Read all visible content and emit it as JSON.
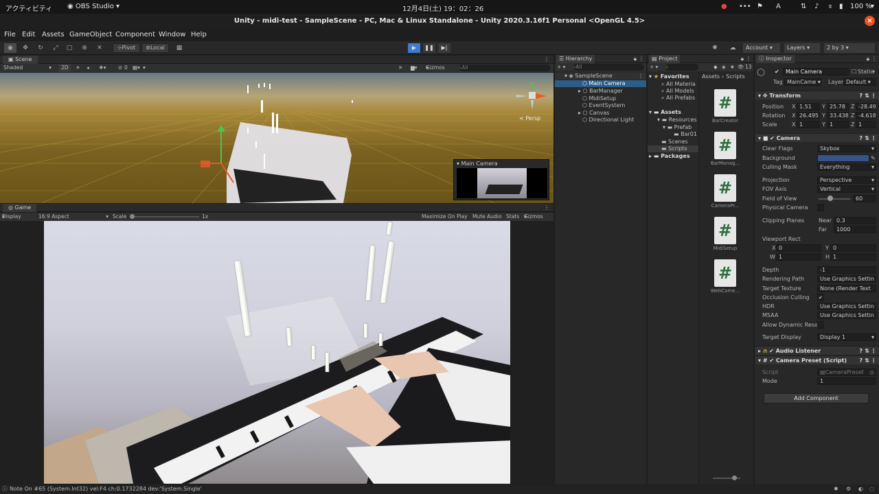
{
  "os_bar": {
    "activities": "アクティビティ",
    "app": "OBS Studio",
    "clock": "12月4日(土) 19：02：26",
    "input_method": "A",
    "battery": "100 %"
  },
  "window": {
    "title": "Unity - midi-test - SampleScene - PC, Mac & Linux Standalone - Unity 2020.3.16f1 Personal <OpenGL 4.5>",
    "close": "×"
  },
  "menu": [
    "File",
    "Edit",
    "Assets",
    "GameObject",
    "Component",
    "Window",
    "Help"
  ],
  "toolbar": {
    "pivot": "Pivot",
    "local": "Local",
    "account": "Account",
    "layers": "Layers",
    "layout": "2 by 3"
  },
  "scene": {
    "tab": "Scene",
    "shading": "Shaded",
    "mode_2d": "2D",
    "hidden_count": "0",
    "gizmos": "Gizmos",
    "search_placeholder": "All",
    "persp": "< Persp",
    "preview_title": "Main Camera"
  },
  "game": {
    "tab": "Game",
    "display": "Display 1",
    "aspect": "16:9 Aspect",
    "scale_label": "Scale",
    "scale_value": "1x",
    "maximize": "Maximize On Play",
    "mute": "Mute Audio",
    "stats": "Stats",
    "gizmos": "Gizmos"
  },
  "hierarchy": {
    "tab": "Hierarchy",
    "search_placeholder": "All",
    "scene": "SampleScene",
    "items": [
      "Main Camera",
      "BarManager",
      "MidiSetup",
      "EventSystem",
      "Canvas",
      "Directional Light"
    ]
  },
  "project": {
    "tab": "Project",
    "count": "13",
    "favorites": "Favorites",
    "fav_items": [
      "All Materia",
      "All Models",
      "All Prefabs"
    ],
    "assets": "Assets",
    "tree": [
      "Resources",
      "Prefab",
      "Bar01",
      "Scenes",
      "Scripts"
    ],
    "packages": "Packages",
    "breadcrumb_root": "Assets",
    "breadcrumb_sep": "›",
    "breadcrumb_leaf": "Scripts",
    "scripts": [
      "BarCreator",
      "BarManag...",
      "CameraPr...",
      "MidiSetup",
      "WebCame..."
    ]
  },
  "inspector": {
    "tab": "Inspector",
    "object_name": "Main Camera",
    "static": "Static",
    "tag_label": "Tag",
    "tag": "MainCame",
    "layer_label": "Layer",
    "layer": "Default",
    "transform": {
      "title": "Transform",
      "position_label": "Position",
      "rotation_label": "Rotation",
      "scale_label": "Scale",
      "position": [
        "1.51",
        "25.78",
        "-28.49"
      ],
      "rotation": [
        "26.495",
        "33.438",
        "-4.618"
      ],
      "scale": [
        "1",
        "1",
        "1"
      ]
    },
    "camera": {
      "title": "Camera",
      "clear_flags_label": "Clear Flags",
      "clear_flags": "Skybox",
      "background_label": "Background",
      "culling_label": "Culling Mask",
      "culling": "Everything",
      "projection_label": "Projection",
      "projection": "Perspective",
      "fov_axis_label": "FOV Axis",
      "fov_axis": "Vertical",
      "fov_label": "Field of View",
      "fov": "60",
      "physical_label": "Physical Camera",
      "clipping_label": "Clipping Planes",
      "near_label": "Near",
      "near": "0.3",
      "far_label": "Far",
      "far": "1000",
      "viewport_label": "Viewport Rect",
      "vx": "0",
      "vy": "0",
      "vw": "1",
      "vh": "1",
      "depth_label": "Depth",
      "depth": "-1",
      "rendering_label": "Rendering Path",
      "rendering": "Use Graphics Settin",
      "target_tex_label": "Target Texture",
      "target_tex": "None (Render Text",
      "occlusion_label": "Occlusion Culling",
      "hdr_label": "HDR",
      "hdr": "Use Graphics Settin",
      "msaa_label": "MSAA",
      "msaa": "Use Graphics Settin",
      "dynres_label": "Allow Dynamic Resol",
      "target_disp_label": "Target Display",
      "target_disp": "Display 1"
    },
    "audio_listener": "Audio Listener",
    "camera_preset": {
      "title": "Camera Preset (Script)",
      "script_label": "Script",
      "script": "CameraPreset",
      "mode_label": "Mode",
      "mode": "1"
    },
    "add_component": "Add Component"
  },
  "status": {
    "message": "Note On #65 (System.Int32) vel:F4 ch:0.1732284 dev:'System.Single'"
  },
  "colors": {
    "selection": "#2c5d87",
    "play_active": "#3e7ccf",
    "background_swatch": "#36538a",
    "close": "#e95420"
  }
}
